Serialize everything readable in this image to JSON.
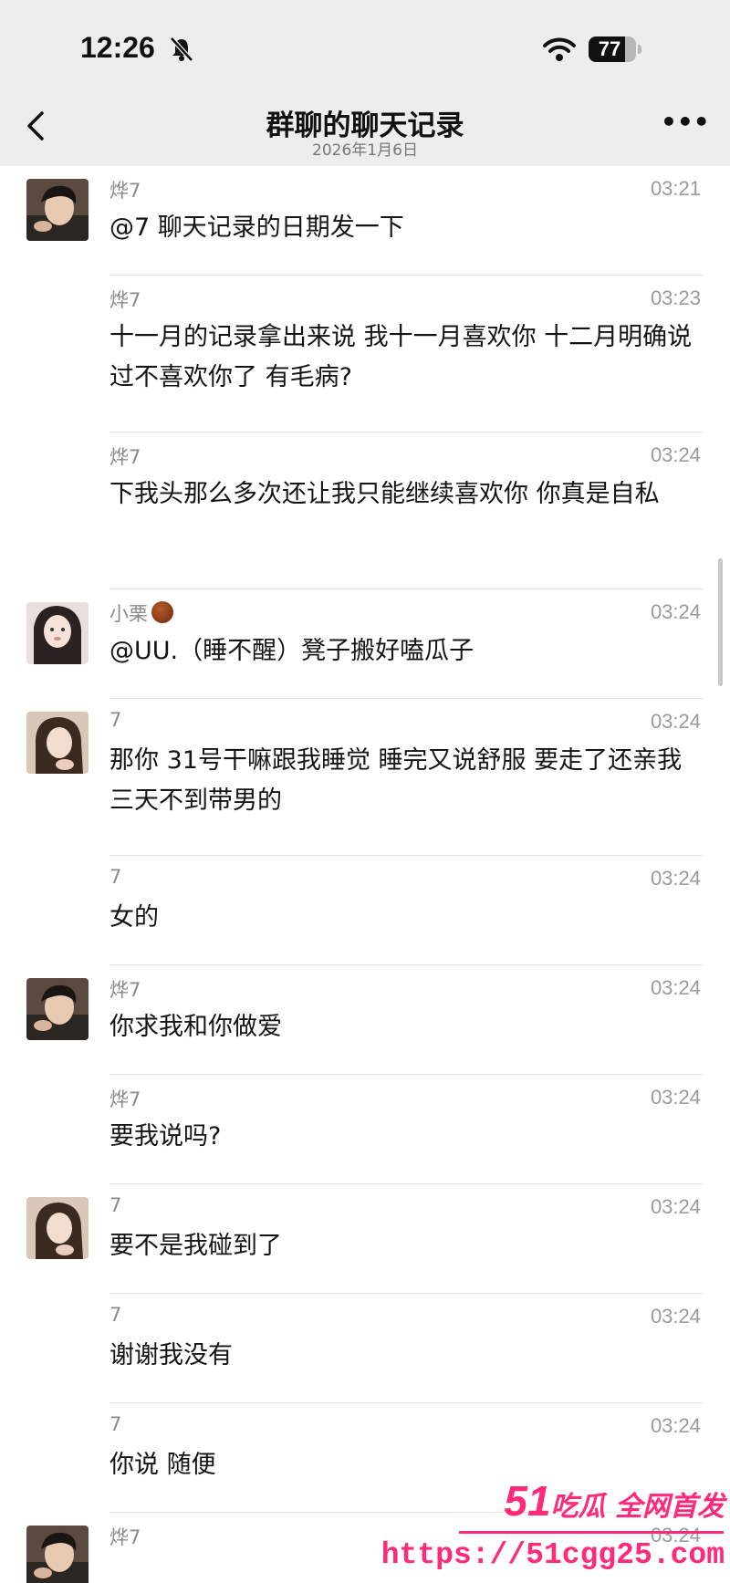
{
  "status_bar": {
    "time": "12:26",
    "battery": "77",
    "battery_level": 0.77
  },
  "nav": {
    "title": "群聊的聊天记录",
    "subtitle": "2026年1月6日",
    "more": "•••"
  },
  "messages": [
    {
      "sender": "烨7",
      "time": "03:21",
      "text": "@7 聊天记录的日期发一下",
      "avatar": "male-avatar"
    },
    {
      "sender": "烨7",
      "time": "03:23",
      "text": "十一月的记录拿出来说 我十一月喜欢你 十二月明确说过不喜欢你了 有毛病?",
      "avatar": ""
    },
    {
      "sender": "烨7",
      "time": "03:24",
      "text": "下我头那么多次还让我只能继续喜欢你 你真是自私",
      "avatar": ""
    },
    {
      "sender": "小栗",
      "time": "03:24",
      "text": "@UU.（睡不醒）凳子搬好嗑瓜子",
      "avatar": "female-avatar-xiaoli"
    },
    {
      "sender": "7",
      "time": "03:24",
      "text": "那你 31号干嘛跟我睡觉 睡完又说舒服 要走了还亲我 三天不到带男的",
      "avatar": "female-avatar"
    },
    {
      "sender": "7",
      "time": "03:24",
      "text": "女的",
      "avatar": ""
    },
    {
      "sender": "烨7",
      "time": "03:24",
      "text": "你求我和你做爱",
      "avatar": "male-avatar"
    },
    {
      "sender": "烨7",
      "time": "03:24",
      "text": "要我说吗?",
      "avatar": ""
    },
    {
      "sender": "7",
      "time": "03:24",
      "text": "要不是我碰到了",
      "avatar": "female-avatar"
    },
    {
      "sender": "7",
      "time": "03:24",
      "text": "谢谢我没有",
      "avatar": ""
    },
    {
      "sender": "7",
      "time": "03:24",
      "text": "你说 随便",
      "avatar": ""
    },
    {
      "sender": "烨7",
      "time": "03:24",
      "text": "",
      "avatar": "male-avatar"
    }
  ],
  "watermark": {
    "line1_num": "51",
    "line1_text": "吃瓜 全网首发",
    "line2": "https://51cgg25.com"
  },
  "colors": {
    "bar_bg": "#ededed",
    "watermark": "#ff2a7a",
    "sender_gray": "#8a8a8a"
  }
}
